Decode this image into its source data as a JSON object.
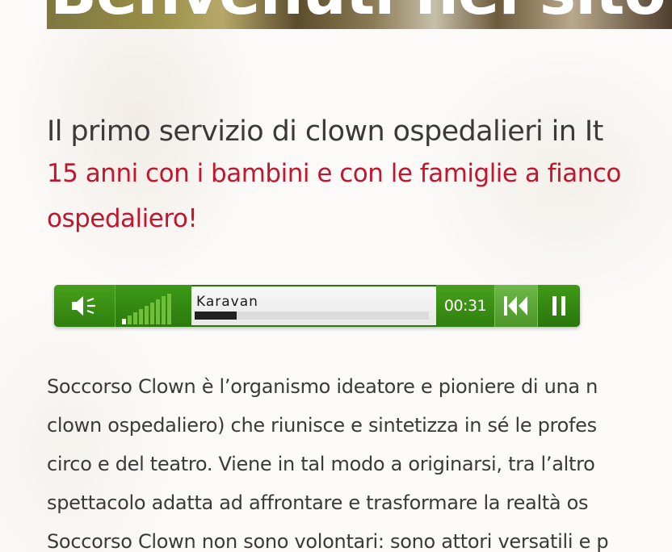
{
  "hero": {
    "title": "Benvenuti nel sito"
  },
  "intro": {
    "subtitle": "Il primo servizio di clown ospedalieri in It",
    "tagline_line1": "15 anni con i bambini e con le famiglie a fianco",
    "tagline_line2": "ospedaliero!"
  },
  "player": {
    "track_title": "Karavan",
    "time": "00:31",
    "progress": 0.18,
    "volume_icon": "speaker-icon",
    "prev_icon": "skip-back-icon",
    "pause_icon": "pause-icon",
    "accent_color": "#2e8510"
  },
  "body": {
    "lines": [
      "Soccorso Clown è l’organismo ideatore e pioniere di una n",
      "clown ospedaliero) che riunisce e sintetizza in sé le profes",
      "circo e del teatro. Viene in tal modo a originarsi, tra l’altro",
      "spettacolo adatta ad affrontare e trasformare la realtà os",
      "Soccorso Clown non sono volontari: sono attori versatili e p"
    ]
  }
}
